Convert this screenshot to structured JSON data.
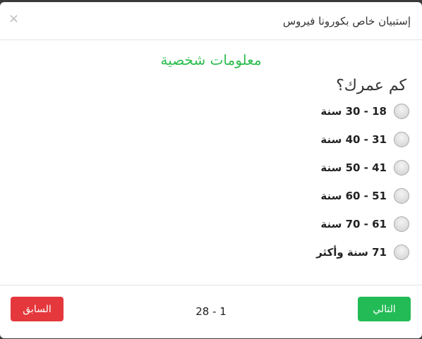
{
  "header": {
    "title": "إستبيان خاص بكورونا فيروس",
    "close": "×"
  },
  "section_title": "معلومات شخصية",
  "question": "كم عمرك؟",
  "options": [
    "18 - 30 سنة",
    "31 - 40 سنة",
    "41 - 50 سنة",
    "51 - 60 سنة",
    "61 - 70 سنة",
    "71 سنة وأكثر"
  ],
  "footer": {
    "next": "التالي",
    "prev": "السابق",
    "pager": "1 - 28"
  },
  "colors": {
    "accent": "#22bb55",
    "danger": "#e4383c"
  }
}
